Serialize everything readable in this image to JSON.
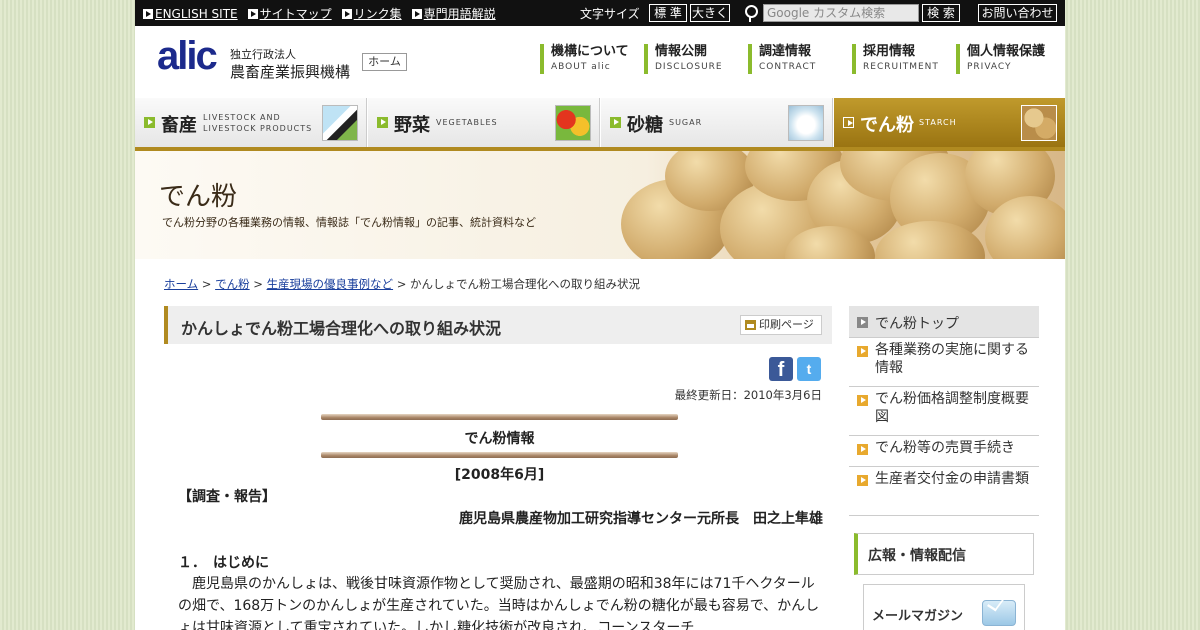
{
  "utility": {
    "links": [
      "ENGLISH SITE",
      "サイトマップ",
      "リンク集",
      "専門用語解説"
    ],
    "font_size_label": "文字サイズ",
    "font_standard": "標 準",
    "font_large": "大きく",
    "search_placeholder": "Google カスタム検索",
    "search_button": "検 索",
    "contact_button": "お問い合わせ"
  },
  "header": {
    "logo": "alic",
    "org_type": "独立行政法人",
    "org_name": "農畜産業振興機構",
    "home_button": "ホーム",
    "nav": [
      {
        "label": "機構について",
        "en": "ABOUT alic"
      },
      {
        "label": "情報公開",
        "en": "DISCLOSURE"
      },
      {
        "label": "調達情報",
        "en": "CONTRACT"
      },
      {
        "label": "採用情報",
        "en": "RECRUITMENT"
      },
      {
        "label": "個人情報保護",
        "en": "PRIVACY"
      }
    ]
  },
  "categories": [
    {
      "label": "畜産",
      "en1": "LIVESTOCK AND",
      "en2": "LIVESTOCK PRODUCTS"
    },
    {
      "label": "野菜",
      "en1": "VEGETABLES",
      "en2": ""
    },
    {
      "label": "砂糖",
      "en1": "SUGAR",
      "en2": ""
    },
    {
      "label": "でん粉",
      "en1": "STARCH",
      "en2": ""
    }
  ],
  "hero": {
    "title": "でん粉",
    "subtitle": "でん粉分野の各種業務の情報、情報誌「でん粉情報」の記事、統計資料など"
  },
  "breadcrumb": {
    "home": "ホーム",
    "sep": " > ",
    "category": "でん粉",
    "section": "生産現場の優良事例など",
    "current": "かんしょでん粉工場合理化への取り組み状況"
  },
  "article": {
    "title": "かんしょでん粉工場合理化への取り組み状況",
    "print": "印刷ページ",
    "facebook": "f",
    "twitter": "t",
    "updated": "最終更新日：2010年3月6日",
    "journal": "でん粉情報",
    "issue": "[2008年6月]",
    "report_type": "【調査・報告】",
    "author": "鹿児島県農産物加工研究指導センター元所長　田之上隼雄",
    "section_heading": "１．　はじめに",
    "body": "　鹿児島県のかんしょは、戦後甘味資源作物として奨励され、最盛期の昭和38年には71千ヘクタールの畑で、168万トンのかんしょが生産されていた。当時はかんしょでん粉の糖化が最も容易で、かんしょは甘味資源として重宝されていた。しかし糖化技術が改良され、コーンスターチ"
  },
  "sidebar": {
    "top": "でん粉トップ",
    "items": [
      "各種業務の実施に関する情報",
      "でん粉価格調整制度概要図",
      "でん粉等の売買手続き",
      "生産者交付金の申請書類"
    ],
    "pr_title": "広報・情報配信",
    "mail_title": "メールマガジン"
  },
  "colors": {
    "accent_green": "#8bbb2d",
    "accent_gold": "#b08a20",
    "logo_navy": "#1c2a8c",
    "link_blue": "#1a3f9c"
  }
}
